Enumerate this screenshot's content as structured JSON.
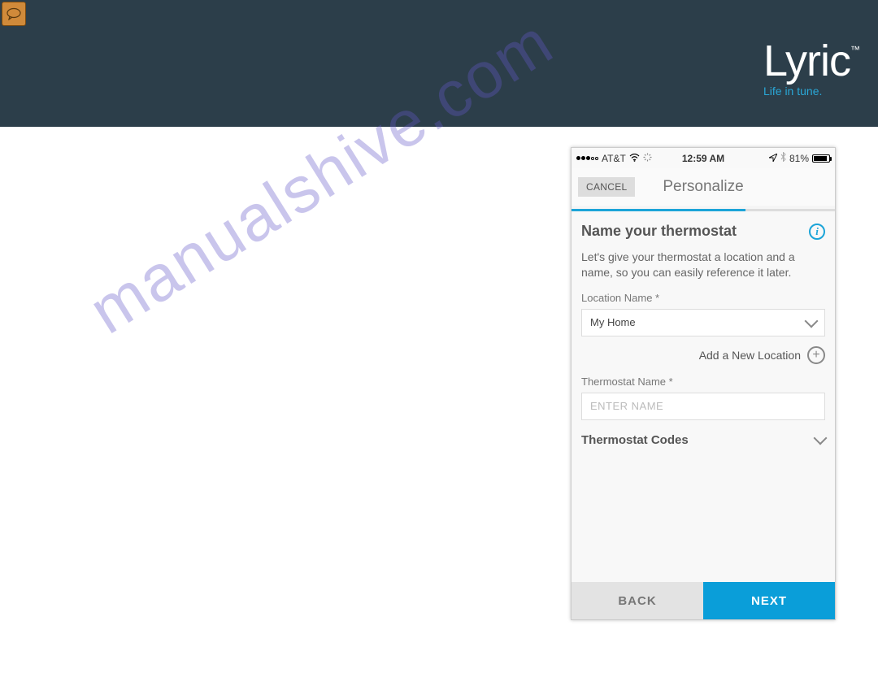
{
  "banner": {
    "logo_text": "Lyric",
    "logo_tm": "™",
    "tagline": "Life in tune."
  },
  "watermark": "manualshive.com",
  "statusbar": {
    "carrier": "AT&T",
    "time": "12:59 AM",
    "battery_pct": "81%"
  },
  "nav": {
    "cancel": "CANCEL",
    "title": "Personalize"
  },
  "section": {
    "title": "Name your thermostat",
    "description": "Let's give your thermostat a location and a name, so you can easily reference it later."
  },
  "fields": {
    "location_label": "Location Name *",
    "location_value": "My Home",
    "add_location": "Add a New Location",
    "thermostat_label": "Thermostat Name *",
    "thermostat_placeholder": "ENTER NAME",
    "codes_label": "Thermostat Codes"
  },
  "buttons": {
    "back": "BACK",
    "next": "NEXT"
  }
}
